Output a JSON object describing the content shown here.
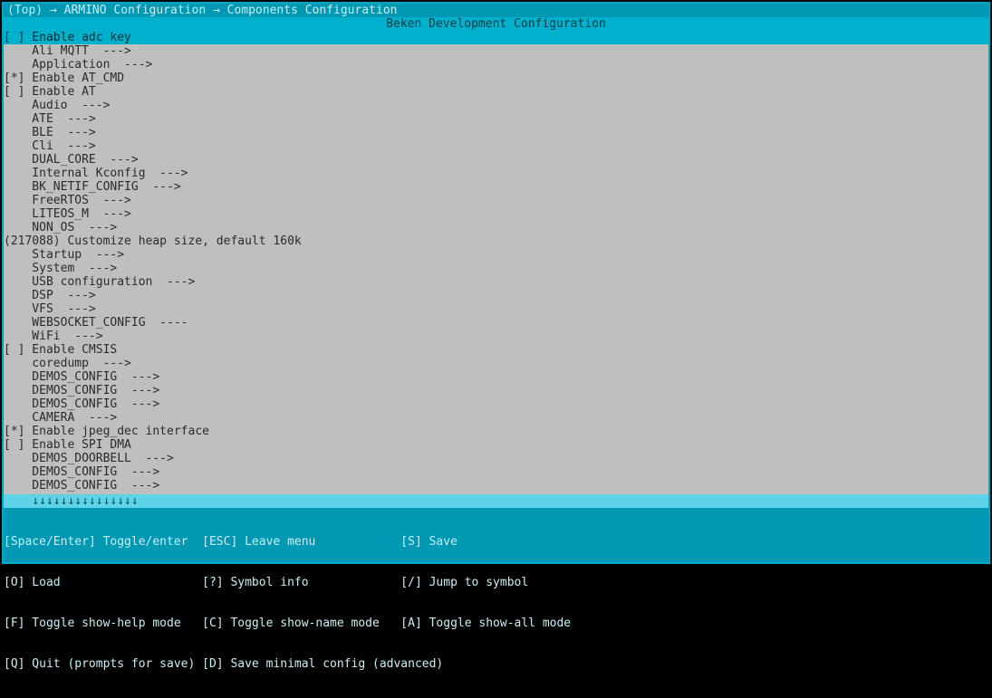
{
  "colors": {
    "border": "#00a7c2",
    "breadcrumb_bg": "#0098b2",
    "titlebar_bg": "#00b0cc",
    "main_bg": "#bfbfbf",
    "footer_bg": "#0098b2"
  },
  "breadcrumb": "(Top) → ARMINO Configuration → Components Configuration",
  "title": "Beken Development Configuration",
  "menu": [
    {
      "prefix": "[ ]",
      "label": "Enable adc key",
      "suffix": "",
      "selected": true
    },
    {
      "prefix": "   ",
      "label": "Ali MQTT",
      "suffix": "  --->"
    },
    {
      "prefix": "   ",
      "label": "Application",
      "suffix": "  --->"
    },
    {
      "prefix": "[*]",
      "label": "Enable AT_CMD",
      "suffix": ""
    },
    {
      "prefix": "[ ]",
      "label": "Enable AT",
      "suffix": ""
    },
    {
      "prefix": "   ",
      "label": "Audio",
      "suffix": "  --->"
    },
    {
      "prefix": "   ",
      "label": "ATE",
      "suffix": "  --->"
    },
    {
      "prefix": "   ",
      "label": "BLE",
      "suffix": "  --->"
    },
    {
      "prefix": "   ",
      "label": "Cli",
      "suffix": "  --->"
    },
    {
      "prefix": "   ",
      "label": "DUAL_CORE",
      "suffix": "  --->"
    },
    {
      "prefix": "   ",
      "label": "Internal Kconfig",
      "suffix": "  --->"
    },
    {
      "prefix": "   ",
      "label": "BK_NETIF_CONFIG",
      "suffix": "  --->"
    },
    {
      "prefix": "   ",
      "label": "FreeRTOS",
      "suffix": "  --->"
    },
    {
      "prefix": "   ",
      "label": "LITEOS_M",
      "suffix": "  --->"
    },
    {
      "prefix": "   ",
      "label": "NON_OS",
      "suffix": "  --->"
    },
    {
      "prefix": "(217088)",
      "label": "Customize heap size, default 160k",
      "suffix": "",
      "flush": true
    },
    {
      "prefix": "   ",
      "label": "Startup",
      "suffix": "  --->"
    },
    {
      "prefix": "   ",
      "label": "System",
      "suffix": "  --->"
    },
    {
      "prefix": "   ",
      "label": "USB configuration",
      "suffix": "  --->"
    },
    {
      "prefix": "   ",
      "label": "DSP",
      "suffix": "  --->"
    },
    {
      "prefix": "   ",
      "label": "VFS",
      "suffix": "  --->"
    },
    {
      "prefix": "   ",
      "label": "WEBSOCKET_CONFIG",
      "suffix": "  ----"
    },
    {
      "prefix": "   ",
      "label": "WiFi",
      "suffix": "  --->"
    },
    {
      "prefix": "[ ]",
      "label": "Enable CMSIS",
      "suffix": ""
    },
    {
      "prefix": "   ",
      "label": "coredump",
      "suffix": "  --->"
    },
    {
      "prefix": "   ",
      "label": "DEMOS_CONFIG",
      "suffix": "  --->"
    },
    {
      "prefix": "   ",
      "label": "DEMOS_CONFIG",
      "suffix": "  --->"
    },
    {
      "prefix": "   ",
      "label": "DEMOS_CONFIG",
      "suffix": "  --->"
    },
    {
      "prefix": "   ",
      "label": "CAMERA",
      "suffix": "  --->"
    },
    {
      "prefix": "[*]",
      "label": "Enable jpeg_dec interface",
      "suffix": ""
    },
    {
      "prefix": "[ ]",
      "label": "Enable SPI DMA",
      "suffix": ""
    },
    {
      "prefix": "   ",
      "label": "DEMOS_DOORBELL",
      "suffix": "  --->"
    },
    {
      "prefix": "   ",
      "label": "DEMOS_CONFIG",
      "suffix": "  --->"
    },
    {
      "prefix": "   ",
      "label": "DEMOS_CONFIG",
      "suffix": "  --->"
    }
  ],
  "scroll_hint": "    ↓↓↓↓↓↓↓↓↓↓↓↓↓↓↓",
  "footer": {
    "r0": {
      "k0": "[Space/Enter]",
      "t0": "Toggle/enter",
      "k1": "[ESC]",
      "t1": "Leave menu",
      "k2": "[S]",
      "t2": "Save"
    },
    "r1": {
      "k0": "[O]",
      "t0": "Load",
      "k1": "[?]",
      "t1": "Symbol info",
      "k2": "[/]",
      "t2": "Jump to symbol"
    },
    "r2": {
      "k0": "[F]",
      "t0": "Toggle show-help mode",
      "k1": "[C]",
      "t1": "Toggle show-name mode",
      "k2": "[A]",
      "t2": "Toggle show-all mode"
    },
    "r3": {
      "k0": "[Q]",
      "t0": "Quit (prompts for save)",
      "k1": "[D]",
      "t1": "Save minimal config (advanced)",
      "k2": "",
      "t2": ""
    }
  }
}
